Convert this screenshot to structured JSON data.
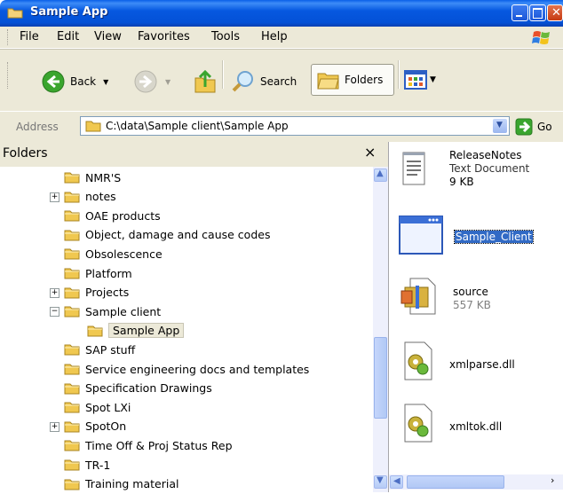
{
  "window": {
    "title": "Sample App"
  },
  "menu": [
    "File",
    "Edit",
    "View",
    "Favorites",
    "Tools",
    "Help"
  ],
  "toolbar": {
    "back": "Back",
    "search": "Search",
    "folders": "Folders"
  },
  "address": {
    "label": "Address",
    "path": "C:\\data\\Sample client\\Sample App",
    "go": "Go"
  },
  "folders_pane": {
    "title": "Folders",
    "close": "×",
    "items": [
      {
        "label": "NMR'S",
        "expander": ""
      },
      {
        "label": "notes",
        "expander": "+"
      },
      {
        "label": "OAE products",
        "expander": ""
      },
      {
        "label": "Object, damage and cause codes",
        "expander": ""
      },
      {
        "label": "Obsolescence",
        "expander": ""
      },
      {
        "label": "Platform",
        "expander": ""
      },
      {
        "label": "Projects",
        "expander": "+"
      },
      {
        "label": "Sample client",
        "expander": "−"
      },
      {
        "label": "Sample App",
        "expander": ""
      },
      {
        "label": "SAP stuff",
        "expander": ""
      },
      {
        "label": "Service engineering docs and templates",
        "expander": ""
      },
      {
        "label": "Specification Drawings",
        "expander": ""
      },
      {
        "label": "Spot LXi",
        "expander": ""
      },
      {
        "label": "SpotOn",
        "expander": "+"
      },
      {
        "label": "Time Off & Proj Status Rep",
        "expander": ""
      },
      {
        "label": "TR-1",
        "expander": ""
      },
      {
        "label": "Training material",
        "expander": ""
      }
    ]
  },
  "files": [
    {
      "name": "ReleaseNotes",
      "type": "Text Document",
      "size": "9 KB",
      "icon": "text-document-icon"
    },
    {
      "name": "Sample_Client",
      "type": "",
      "size": "",
      "icon": "application-window-icon"
    },
    {
      "name": "source",
      "type": "",
      "size": "557 KB",
      "icon": "zip-archive-icon"
    },
    {
      "name": "xmlparse.dll",
      "type": "",
      "size": "",
      "icon": "dll-gear-icon"
    },
    {
      "name": "xmltok.dll",
      "type": "",
      "size": "",
      "icon": "dll-gear-icon"
    }
  ],
  "colors": {
    "titlebar": "#0658e0",
    "chrome": "#ece9d8",
    "selection": "#316ac5"
  }
}
